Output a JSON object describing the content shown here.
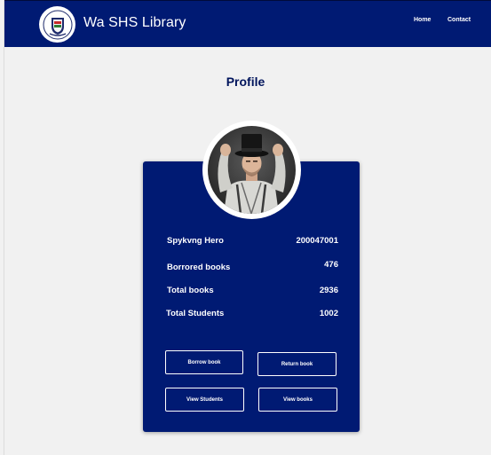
{
  "navbar": {
    "brand": "Wa SHS Library",
    "links": {
      "home": "Home",
      "contact": "Contact"
    },
    "color": "#001a73"
  },
  "page": {
    "title": "Profile"
  },
  "profile": {
    "name": "Spykvng Hero",
    "id": "200047001",
    "stats": [
      {
        "label": "Borrored books",
        "value": "476"
      },
      {
        "label": "Total books",
        "value": "2936"
      },
      {
        "label": "Total Students",
        "value": "1002"
      }
    ]
  },
  "actions": {
    "borrow_book": "Borrow book",
    "return_book": "Return book",
    "view_students": "View Students",
    "view_books": "View books"
  }
}
